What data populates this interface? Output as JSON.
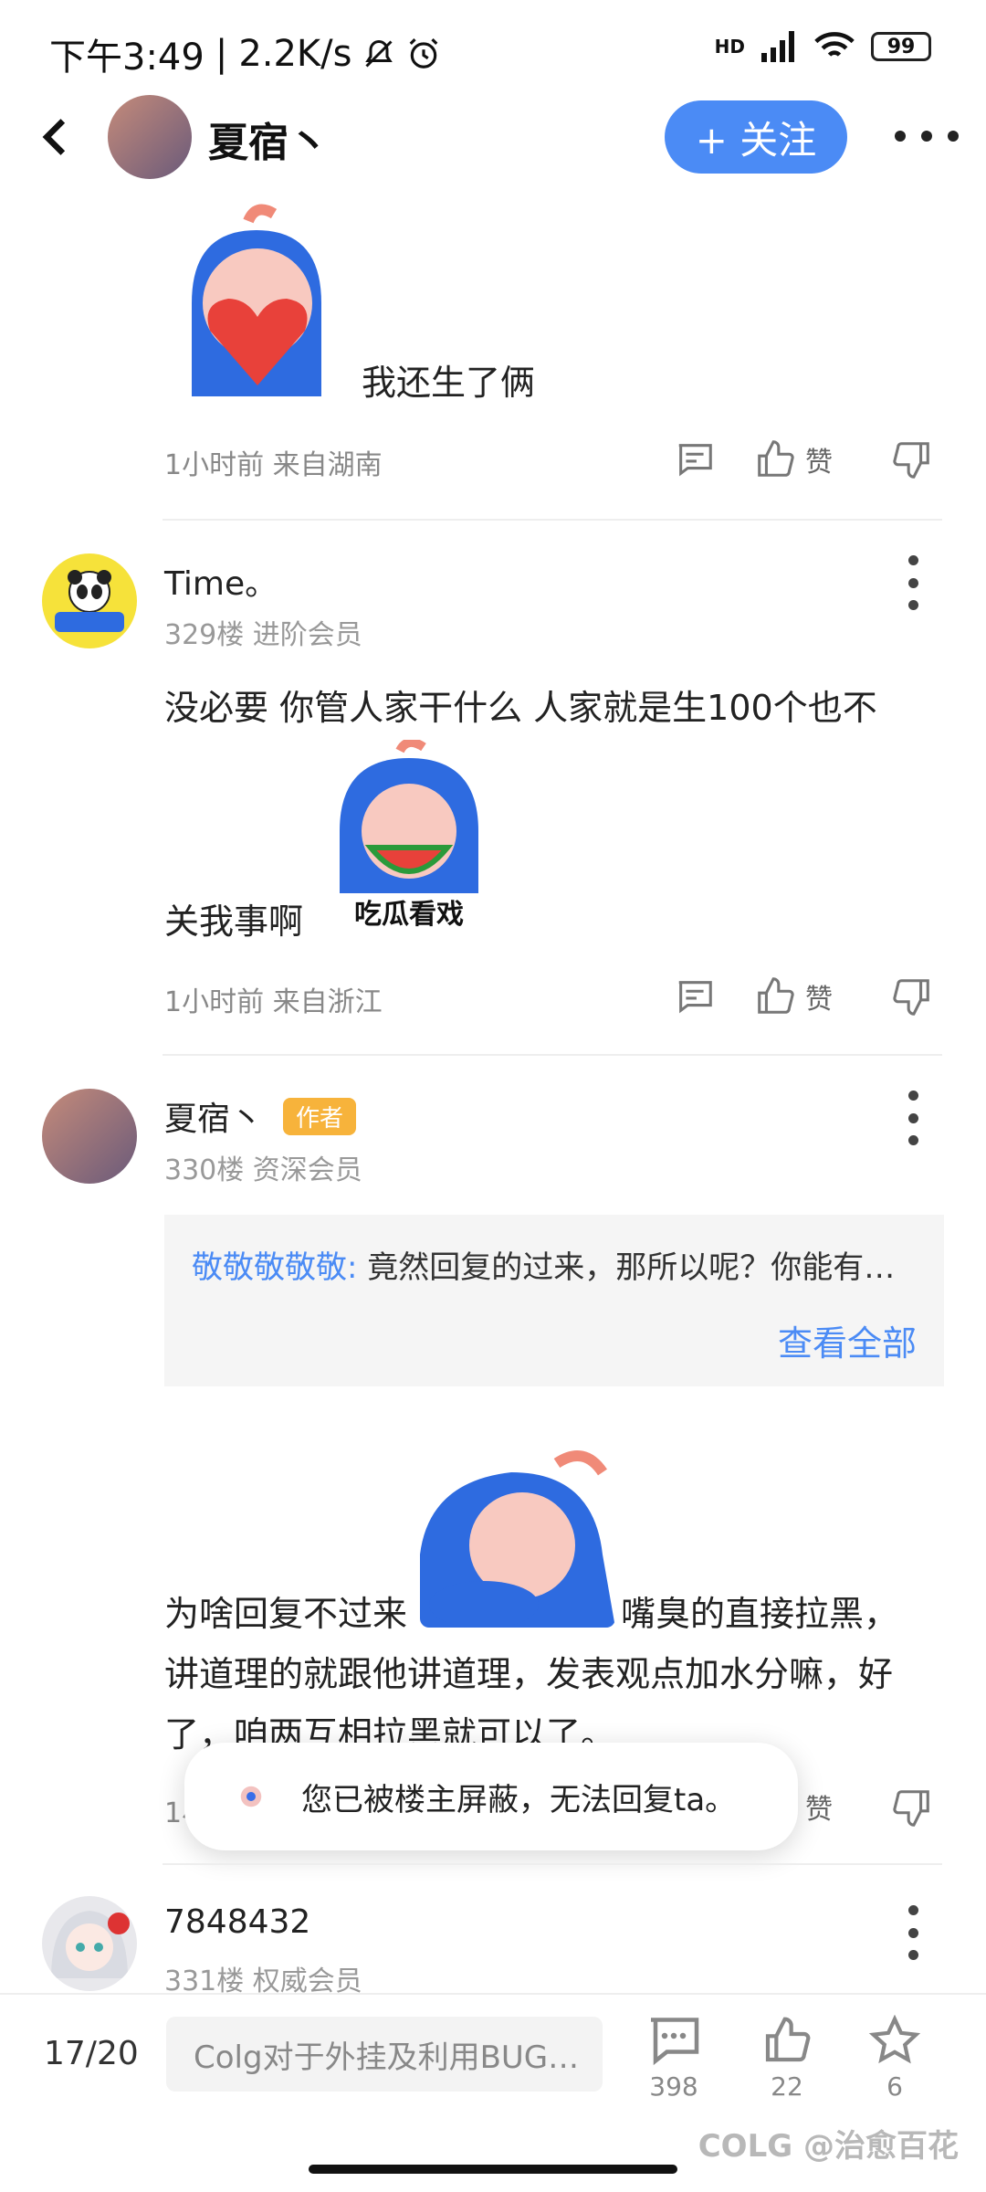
{
  "status_bar": {
    "time": "下午3:49",
    "speed": "2.2K/s",
    "network": "HD",
    "battery": "99"
  },
  "header": {
    "author_name": "夏宿丶",
    "follow_label": "+ 关注"
  },
  "posts": [
    {
      "text": "我还生了俩",
      "meta": "1小时前 来自湖南",
      "like_label": "赞"
    },
    {
      "username": "Time。",
      "floor": "329楼 进阶会员",
      "text_line1": "没必要 你管人家干什么 人家就是生100个也不",
      "text_line2": "关我事啊",
      "sticker_caption": "吃瓜看戏",
      "meta": "1小时前 来自浙江",
      "like_label": "赞"
    },
    {
      "username": "夏宿丶",
      "badge": "作者",
      "floor": "330楼 资深会员",
      "quote_user": "敬敬敬敬敬:",
      "quote_text": "竟然回复的过来，那所以呢？你能有…",
      "quote_more": "查看全部",
      "text_line1": "为啥回复不过来",
      "text_line1b": "嘴臭的直接拉黑，",
      "text_line2": "讲道理的就跟他讲道理，发表观点加水分嘛，好",
      "text_line3": "了，咱两互相拉黑就可以了。",
      "meta_partial": "1小",
      "like_label": "赞"
    },
    {
      "username": "7848432",
      "floor": "331楼 权威会员"
    }
  ],
  "toast": {
    "text": "您已被楼主屏蔽，无法回复ta。"
  },
  "bottom_bar": {
    "page": "17/20",
    "input_placeholder": "Colg对于外挂及利用BUG…",
    "comments": "398",
    "likes": "22",
    "favorites": "6"
  },
  "watermark": "COLG @治愈百花",
  "colors": {
    "accent": "#4b8bf5",
    "badge": "#f7b33b"
  }
}
